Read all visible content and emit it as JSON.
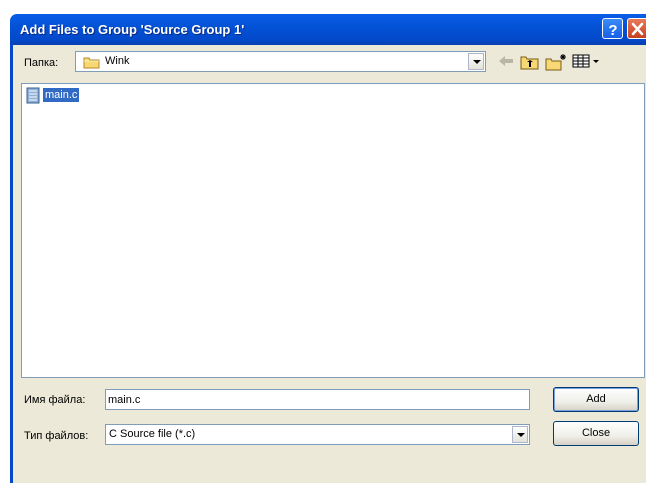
{
  "window": {
    "title": "Add Files to Group 'Source Group 1'",
    "title_color": "#ffffff",
    "titlebar_color": "#0352d6"
  },
  "lookin": {
    "label": "Папка:",
    "value": "Wink",
    "icon": "folder-icon"
  },
  "toolbar": {
    "icons": [
      "back-icon",
      "up-folder-icon",
      "new-folder-icon",
      "view-menu-icon"
    ]
  },
  "file_list": {
    "items": [
      {
        "name": "main.c",
        "icon": "c-file-icon",
        "selected": true
      }
    ],
    "selection_color": "#316ac5"
  },
  "filename": {
    "label": "Имя файла:",
    "value": "main.c"
  },
  "filetype": {
    "label": "Тип файлов:",
    "value": "C Source file (*.c)"
  },
  "buttons": {
    "add_label": "Add",
    "close_label": "Close"
  }
}
